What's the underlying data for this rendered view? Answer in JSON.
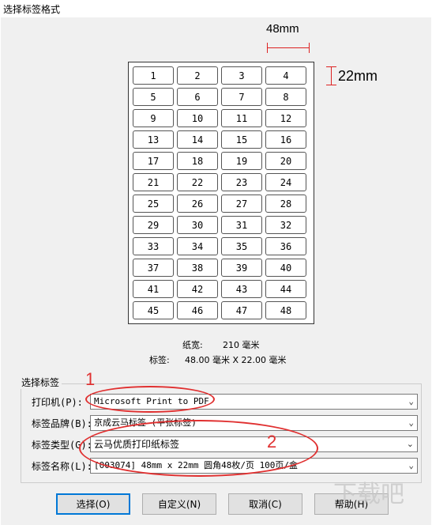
{
  "window": {
    "title": "选择标签格式"
  },
  "dimensions": {
    "width_label": "48mm",
    "height_label": "22mm"
  },
  "labels_grid": [
    "1",
    "2",
    "3",
    "4",
    "5",
    "6",
    "7",
    "8",
    "9",
    "10",
    "11",
    "12",
    "13",
    "14",
    "15",
    "16",
    "17",
    "18",
    "19",
    "20",
    "21",
    "22",
    "23",
    "24",
    "25",
    "26",
    "27",
    "28",
    "29",
    "30",
    "31",
    "32",
    "33",
    "34",
    "35",
    "36",
    "37",
    "38",
    "39",
    "40",
    "41",
    "42",
    "43",
    "44",
    "45",
    "46",
    "47",
    "48"
  ],
  "paper_info": {
    "width_label": "纸宽:",
    "width_value": "210 毫米",
    "label_label": "标签:",
    "label_value": "48.00 毫米 X 22.00 毫米"
  },
  "group": {
    "title": "选择标签"
  },
  "fields": {
    "printer_label": "打印机(P):",
    "printer_value": "Microsoft Print to PDF",
    "brand_label": "标签品牌(B):",
    "brand_value": "京成云马标签 (平张标签)",
    "type_label": "标签类型(G):",
    "type_value": "云马优质打印纸标签",
    "name_label": "标签名称(L):",
    "name_value": "[003074] 48mm x 22mm 圆角48枚/页 100页/盒"
  },
  "annotations": {
    "marker1": "1",
    "marker2": "2"
  },
  "buttons": {
    "select": "选择(O)",
    "custom": "自定义(N)",
    "cancel": "取消(C)",
    "help": "帮助(H)"
  },
  "watermark": "下载吧",
  "colors": {
    "annotation_red": "#e03030",
    "default_button_border": "#0078d7"
  }
}
